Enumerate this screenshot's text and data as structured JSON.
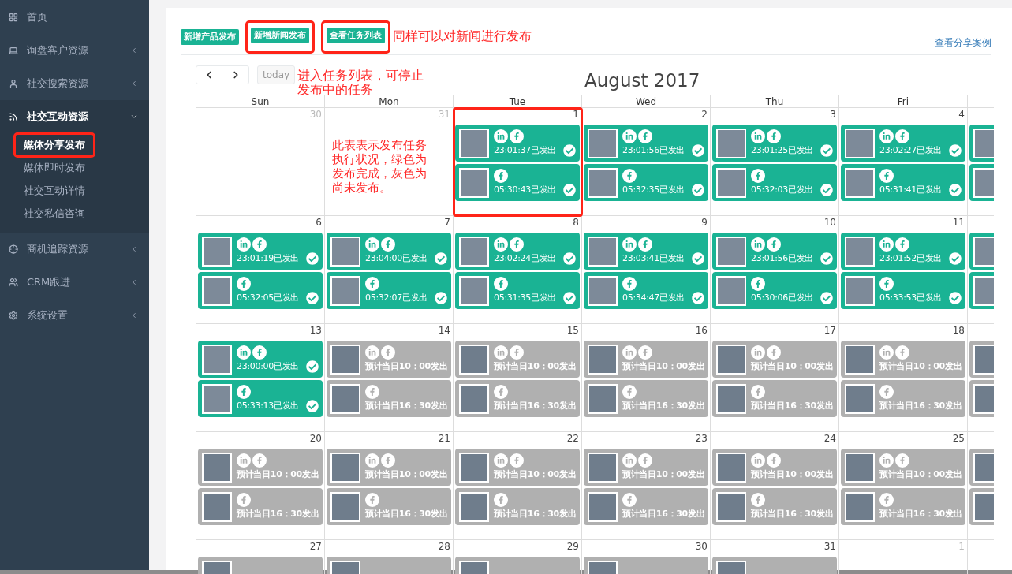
{
  "sidebar": {
    "items": [
      {
        "kind": "link",
        "label": "首页",
        "expanded": false
      },
      {
        "kind": "menu",
        "label": "询盘客户资源",
        "expanded": false
      },
      {
        "kind": "menu",
        "label": "社交搜索资源",
        "expanded": false
      },
      {
        "kind": "menu",
        "label": "社交互动资源",
        "expanded": true,
        "children": [
          {
            "label": "媒体分享发布",
            "selected": true,
            "highlighted": true
          },
          {
            "label": "媒体即时发布",
            "selected": false,
            "highlighted": false
          },
          {
            "label": "社交互动详情",
            "selected": false,
            "highlighted": false
          },
          {
            "label": "社交私信咨询",
            "selected": false,
            "highlighted": false
          }
        ]
      },
      {
        "kind": "menu",
        "label": "商机追踪资源",
        "expanded": false
      },
      {
        "kind": "menu",
        "label": "CRM跟进",
        "expanded": false
      },
      {
        "kind": "menu",
        "label": "系统设置",
        "expanded": false
      }
    ]
  },
  "toolbar": {
    "buttons": [
      {
        "label": "新增产品发布",
        "highlighted": false
      },
      {
        "label": "新增新闻发布",
        "highlighted": true
      },
      {
        "label": "查看任务列表",
        "highlighted": true
      }
    ],
    "link": "查看分享案例"
  },
  "annotations": [
    {
      "kind": "top",
      "text": "同样可以对新闻进行发布"
    },
    {
      "kind": "nav",
      "text": "进入任务列表，可停止发布中的任务"
    },
    {
      "kind": "legend",
      "text": "此表表示发布任务执行状况，绿色为发布完成，灰色为尚未发布。"
    }
  ],
  "calendar": {
    "title": "August 2017",
    "today_label": "today",
    "columns": [
      "Sun",
      "Mon",
      "Tue",
      "Wed",
      "Thu",
      "Fri"
    ],
    "weeks": [
      {
        "days": [
          {
            "date": "30",
            "other_month": true,
            "highlighted": false
          },
          {
            "date": "31",
            "other_month": true,
            "highlighted": false
          },
          {
            "date": "1",
            "other_month": false,
            "highlighted": true,
            "events": [
              {
                "sent": true,
                "linkedin": true,
                "facebook": true,
                "time": "23:01:37已发出"
              },
              {
                "sent": true,
                "linkedin": false,
                "facebook": true,
                "time": "05:30:43已发出"
              }
            ]
          },
          {
            "date": "2",
            "other_month": false,
            "highlighted": false,
            "events": [
              {
                "sent": true,
                "linkedin": true,
                "facebook": true,
                "time": "23:01:56已发出"
              },
              {
                "sent": true,
                "linkedin": false,
                "facebook": true,
                "time": "05:32:35已发出"
              }
            ]
          },
          {
            "date": "3",
            "other_month": false,
            "highlighted": false,
            "events": [
              {
                "sent": true,
                "linkedin": true,
                "facebook": true,
                "time": "23:01:25已发出"
              },
              {
                "sent": true,
                "linkedin": false,
                "facebook": true,
                "time": "05:32:03已发出"
              }
            ]
          },
          {
            "date": "4",
            "other_month": false,
            "highlighted": false,
            "events": [
              {
                "sent": true,
                "linkedin": true,
                "facebook": true,
                "time": "23:02:27已发出"
              },
              {
                "sent": true,
                "linkedin": false,
                "facebook": true,
                "time": "05:31:41已发出"
              }
            ]
          },
          {
            "highlighted": false,
            "events": [
              {
                "sent": true
              },
              {
                "sent": true
              }
            ]
          }
        ]
      },
      {
        "days": [
          {
            "date": "6",
            "other_month": false,
            "highlighted": false,
            "events": [
              {
                "sent": true,
                "linkedin": true,
                "facebook": true,
                "time": "23:01:19已发出"
              },
              {
                "sent": true,
                "linkedin": false,
                "facebook": true,
                "time": "05:32:05已发出"
              }
            ]
          },
          {
            "date": "7",
            "other_month": false,
            "highlighted": false,
            "events": [
              {
                "sent": true,
                "linkedin": true,
                "facebook": true,
                "time": "23:04:00已发出"
              },
              {
                "sent": true,
                "linkedin": false,
                "facebook": true,
                "time": "05:32:07已发出"
              }
            ]
          },
          {
            "date": "8",
            "other_month": false,
            "highlighted": false,
            "events": [
              {
                "sent": true,
                "linkedin": true,
                "facebook": true,
                "time": "23:02:24已发出"
              },
              {
                "sent": true,
                "linkedin": false,
                "facebook": true,
                "time": "05:31:35已发出"
              }
            ]
          },
          {
            "date": "9",
            "other_month": false,
            "highlighted": false,
            "events": [
              {
                "sent": true,
                "linkedin": true,
                "facebook": true,
                "time": "23:03:41已发出"
              },
              {
                "sent": true,
                "linkedin": false,
                "facebook": true,
                "time": "05:34:47已发出"
              }
            ]
          },
          {
            "date": "10",
            "other_month": false,
            "highlighted": false,
            "events": [
              {
                "sent": true,
                "linkedin": true,
                "facebook": true,
                "time": "23:01:56已发出"
              },
              {
                "sent": true,
                "linkedin": false,
                "facebook": true,
                "time": "05:30:06已发出"
              }
            ]
          },
          {
            "date": "11",
            "other_month": false,
            "highlighted": false,
            "events": [
              {
                "sent": true,
                "linkedin": true,
                "facebook": true,
                "time": "23:01:52已发出"
              },
              {
                "sent": true,
                "linkedin": false,
                "facebook": true,
                "time": "05:33:53已发出"
              }
            ]
          },
          {
            "highlighted": false,
            "events": [
              {
                "sent": true
              },
              {
                "sent": true
              }
            ]
          }
        ]
      },
      {
        "days": [
          {
            "date": "13",
            "other_month": false,
            "highlighted": false,
            "events": [
              {
                "sent": true,
                "linkedin": true,
                "facebook": true,
                "time": "23:00:00已发出"
              },
              {
                "sent": true,
                "linkedin": false,
                "facebook": true,
                "time": "05:33:13已发出"
              }
            ]
          },
          {
            "date": "14",
            "other_month": false,
            "highlighted": false,
            "events": [
              {
                "sent": false,
                "linkedin": true,
                "facebook": true,
                "time": "预计当日10：00发出"
              },
              {
                "sent": false,
                "linkedin": false,
                "facebook": true,
                "time": "预计当日16：30发出"
              }
            ]
          },
          {
            "date": "15",
            "other_month": false,
            "highlighted": false,
            "events": [
              {
                "sent": false,
                "linkedin": true,
                "facebook": true,
                "time": "预计当日10：00发出"
              },
              {
                "sent": false,
                "linkedin": false,
                "facebook": true,
                "time": "预计当日16：30发出"
              }
            ]
          },
          {
            "date": "16",
            "other_month": false,
            "highlighted": false,
            "events": [
              {
                "sent": false,
                "linkedin": true,
                "facebook": true,
                "time": "预计当日10：00发出"
              },
              {
                "sent": false,
                "linkedin": false,
                "facebook": true,
                "time": "预计当日16：30发出"
              }
            ]
          },
          {
            "date": "17",
            "other_month": false,
            "highlighted": false,
            "events": [
              {
                "sent": false,
                "linkedin": true,
                "facebook": true,
                "time": "预计当日10：00发出"
              },
              {
                "sent": false,
                "linkedin": false,
                "facebook": true,
                "time": "预计当日16：30发出"
              }
            ]
          },
          {
            "date": "18",
            "other_month": false,
            "highlighted": false,
            "events": [
              {
                "sent": false,
                "linkedin": true,
                "facebook": true,
                "time": "预计当日10：00发出"
              },
              {
                "sent": false,
                "linkedin": false,
                "facebook": true,
                "time": "预计当日16：30发出"
              }
            ]
          },
          {
            "highlighted": false,
            "events": [
              {
                "sent": false
              },
              {
                "sent": false
              }
            ]
          }
        ]
      },
      {
        "days": [
          {
            "date": "20",
            "other_month": false,
            "highlighted": false,
            "events": [
              {
                "sent": false,
                "linkedin": true,
                "facebook": true,
                "time": "预计当日10：00发出"
              },
              {
                "sent": false,
                "linkedin": false,
                "facebook": true,
                "time": "预计当日16：30发出"
              }
            ]
          },
          {
            "date": "21",
            "other_month": false,
            "highlighted": false,
            "events": [
              {
                "sent": false,
                "linkedin": true,
                "facebook": true,
                "time": "预计当日10：00发出"
              },
              {
                "sent": false,
                "linkedin": false,
                "facebook": true,
                "time": "预计当日16：30发出"
              }
            ]
          },
          {
            "date": "22",
            "other_month": false,
            "highlighted": false,
            "events": [
              {
                "sent": false,
                "linkedin": true,
                "facebook": true,
                "time": "预计当日10：00发出"
              },
              {
                "sent": false,
                "linkedin": false,
                "facebook": true,
                "time": "预计当日16：30发出"
              }
            ]
          },
          {
            "date": "23",
            "other_month": false,
            "highlighted": false,
            "events": [
              {
                "sent": false,
                "linkedin": true,
                "facebook": true,
                "time": "预计当日10：00发出"
              },
              {
                "sent": false,
                "linkedin": false,
                "facebook": true,
                "time": "预计当日16：30发出"
              }
            ]
          },
          {
            "date": "24",
            "other_month": false,
            "highlighted": false,
            "events": [
              {
                "sent": false,
                "linkedin": true,
                "facebook": true,
                "time": "预计当日10：00发出"
              },
              {
                "sent": false,
                "linkedin": false,
                "facebook": true,
                "time": "预计当日16：30发出"
              }
            ]
          },
          {
            "date": "25",
            "other_month": false,
            "highlighted": false,
            "events": [
              {
                "sent": false,
                "linkedin": true,
                "facebook": true,
                "time": "预计当日10：00发出"
              },
              {
                "sent": false,
                "linkedin": false,
                "facebook": true,
                "time": "预计当日16：30发出"
              }
            ]
          },
          {
            "highlighted": false,
            "events": [
              {
                "sent": false
              },
              {
                "sent": false
              }
            ]
          }
        ]
      },
      {
        "days": [
          {
            "date": "27",
            "other_month": false,
            "highlighted": false,
            "events": [
              {
                "sent": false
              }
            ]
          },
          {
            "date": "28",
            "other_month": false,
            "highlighted": false,
            "events": [
              {
                "sent": false
              }
            ]
          },
          {
            "date": "29",
            "other_month": false,
            "highlighted": false,
            "events": [
              {
                "sent": false
              }
            ]
          },
          {
            "date": "30",
            "other_month": false,
            "highlighted": false,
            "events": [
              {
                "sent": false
              }
            ]
          },
          {
            "date": "31",
            "other_month": false,
            "highlighted": false,
            "events": [
              {
                "sent": false
              }
            ]
          },
          {
            "date": "1",
            "other_month": true,
            "highlighted": false
          },
          {
            "highlighted": false
          }
        ]
      }
    ]
  }
}
